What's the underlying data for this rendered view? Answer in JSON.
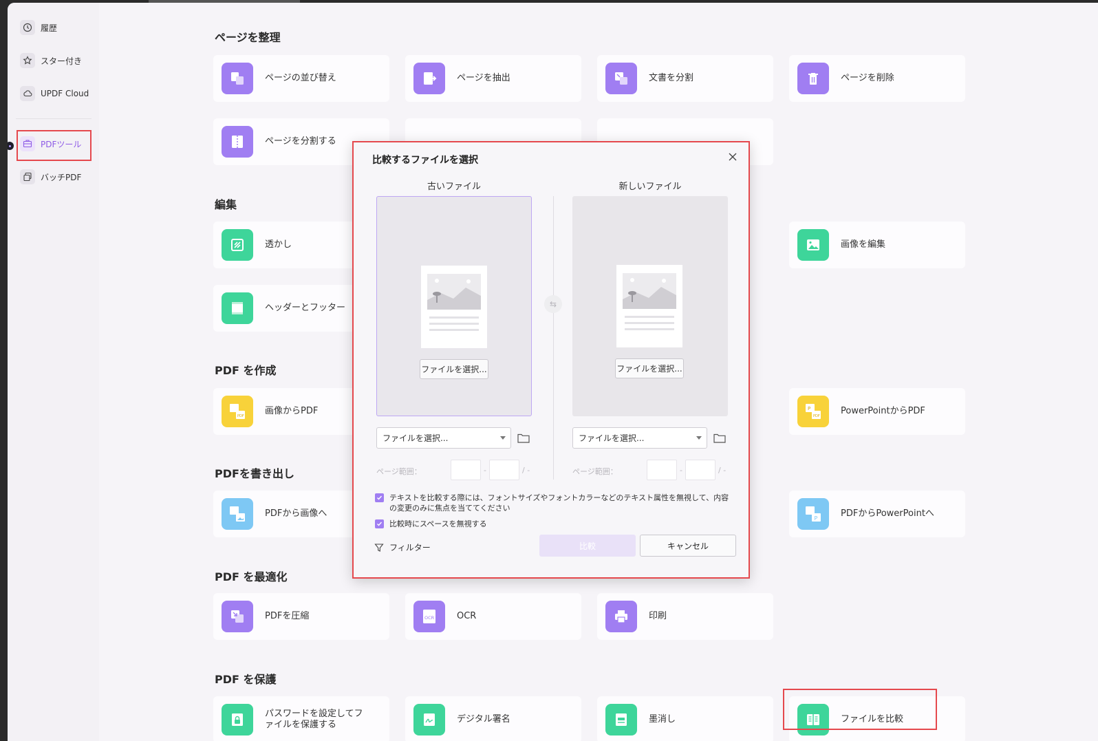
{
  "sidebar": {
    "items": [
      {
        "label": "履歴",
        "icon": "clock-icon"
      },
      {
        "label": "スター付き",
        "icon": "star-icon"
      },
      {
        "label": "UPDF Cloud",
        "icon": "cloud-icon"
      },
      {
        "label": "PDFツール",
        "icon": "toolbox-icon",
        "active": true
      },
      {
        "label": "バッチPDF",
        "icon": "batch-icon"
      }
    ]
  },
  "sections": {
    "organize": {
      "title": "ページを整理",
      "tools": [
        "ページの並び替え",
        "ページを抽出",
        "文書を分割",
        "ページを削除",
        "ページを分割する"
      ]
    },
    "edit": {
      "title": "編集",
      "tools": [
        "透かし",
        "画像を編集",
        "ヘッダーとフッター"
      ]
    },
    "create": {
      "title": "PDF を作成",
      "tools": [
        "画像からPDF",
        "PowerPointからPDF"
      ]
    },
    "export": {
      "title": "PDFを書き出し",
      "tools": [
        "PDFから画像へ",
        "PDFからPowerPointへ"
      ]
    },
    "optimize": {
      "title": "PDF を最適化",
      "tools": [
        "PDFを圧縮",
        "OCR",
        "印刷"
      ]
    },
    "protect": {
      "title": "PDF を保護",
      "tools": [
        "パスワードを設定してファイルを保護する",
        "デジタル署名",
        "墨消し",
        "ファイルを比較"
      ]
    }
  },
  "dialog": {
    "title": "比較するファイルを選択",
    "old_file_label": "古いファイル",
    "new_file_label": "新しいファイル",
    "choose_button": "ファイルを選択...",
    "old_select_value": "ファイルを選択...",
    "new_select_value": "ファイルを選択...",
    "page_range_label": "ページ範囲：",
    "range_dash": "-",
    "range_slash": "/ -",
    "option1": "テキストを比較する際には、フォントサイズやフォントカラーなどのテキスト属性を無視して、内容の変更のみに焦点を当ててください",
    "option2": "比較時にスペースを無視する",
    "filter_label": "フィルター",
    "compare_button": "比較",
    "cancel_button": "キャンセル"
  },
  "colors": {
    "accent": "#a07ef2",
    "highlight": "#e5484d",
    "green": "#3ed59a",
    "yellow": "#f8d23a",
    "blue": "#7ec8f4"
  }
}
